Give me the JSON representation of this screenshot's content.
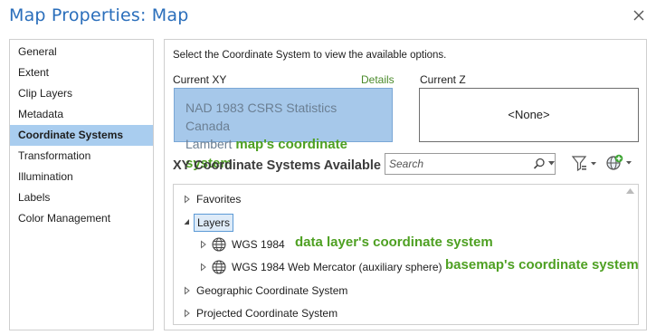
{
  "window": {
    "title": "Map Properties: Map",
    "close_icon": "close-icon"
  },
  "sidebar": {
    "items": [
      {
        "label": "General",
        "active": false
      },
      {
        "label": "Extent",
        "active": false
      },
      {
        "label": "Clip Layers",
        "active": false
      },
      {
        "label": "Metadata",
        "active": false
      },
      {
        "label": "Coordinate Systems",
        "active": true
      },
      {
        "label": "Transformation",
        "active": false
      },
      {
        "label": "Illumination",
        "active": false
      },
      {
        "label": "Labels",
        "active": false
      },
      {
        "label": "Color Management",
        "active": false
      }
    ]
  },
  "main": {
    "instruction": "Select the Coordinate System to view the available options.",
    "current_xy_label": "Current XY",
    "details_link": "Details",
    "current_z_label": "Current Z",
    "current_xy_line1": "NAD 1983 CSRS Statistics Canada",
    "current_xy_line2": "Lambert",
    "current_xy_annotation": "map's coordinate system",
    "current_z_value": "<None>",
    "available_title": "XY Coordinate Systems Available",
    "search_placeholder": "Search"
  },
  "tree": {
    "favorites": "Favorites",
    "layers": "Layers",
    "wgs84": "WGS 1984",
    "wgs84_annotation": "data layer's coordinate system",
    "web_mercator": "WGS 1984 Web Mercator (auxiliary sphere)",
    "web_mercator_annotation": "basemap's coordinate system",
    "geographic": "Geographic Coordinate System",
    "projected": "Projected Coordinate System"
  },
  "colors": {
    "title_blue": "#2a6ebb",
    "selected_nav": "#a9cdef",
    "current_xy_fill": "#a6c8ea",
    "annotation_green": "#4ea022",
    "details_green": "#4a8a2a"
  }
}
